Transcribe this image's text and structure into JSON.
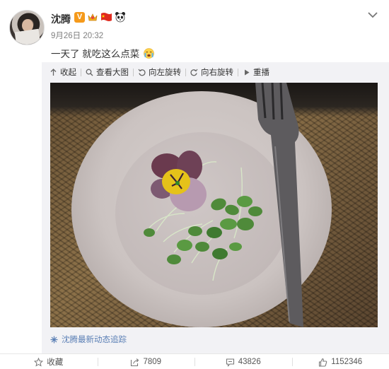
{
  "post": {
    "author": "沈腾",
    "time": "9月26日 20:32",
    "text": "一天了 就吃这么点菜",
    "badges": [
      "verified-v-icon",
      "crown-icon",
      "china-flag-icon",
      "panda-icon"
    ],
    "badge_v": "V"
  },
  "toolbar": {
    "collapse": "收起",
    "view_large": "查看大图",
    "rotate_left": "向左旋转",
    "rotate_right": "向右旋转",
    "repost_tool": "重播"
  },
  "follow_link": "沈腾最新动态追踪",
  "actions": {
    "favorite": "收藏",
    "repost_count": "7809",
    "comment_count": "43826",
    "like_count": "1152346"
  },
  "colors": {
    "link": "#5a7fb5",
    "badge_v": "#f59a1b",
    "panel_bg": "#f2f2f5"
  }
}
